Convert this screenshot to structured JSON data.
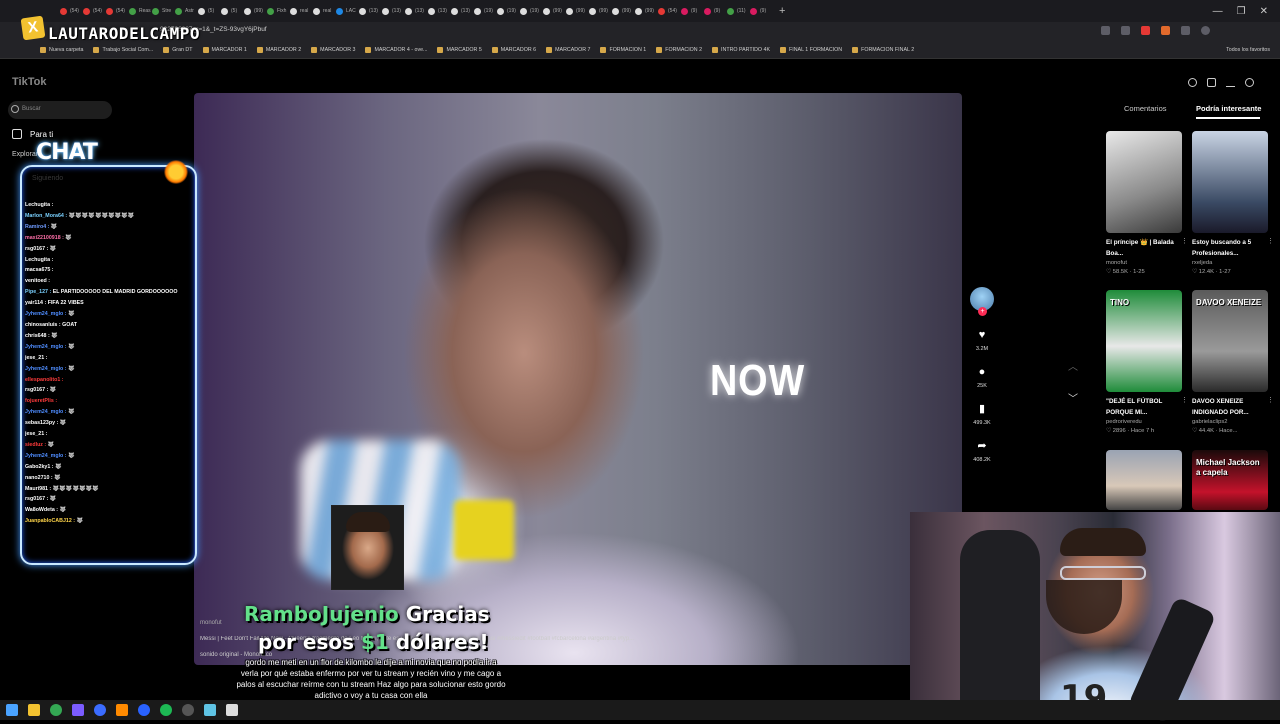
{
  "browser": {
    "tabs": [
      {
        "label": "(54)",
        "color": "#e53935"
      },
      {
        "label": "(54)",
        "color": "#e53935"
      },
      {
        "label": "(54)",
        "color": "#e53935"
      },
      {
        "label": "Reas",
        "color": "#43a047"
      },
      {
        "label": "Stre",
        "color": "#43a047"
      },
      {
        "label": "Astr",
        "color": "#43a047"
      },
      {
        "label": "(5)",
        "color": "#dddddd"
      },
      {
        "label": "(5)",
        "color": "#dddddd"
      },
      {
        "label": "(99)",
        "color": "#dddddd"
      },
      {
        "label": "Fixh",
        "color": "#43a047"
      },
      {
        "label": "real",
        "color": "#dddddd"
      },
      {
        "label": "real",
        "color": "#dddddd"
      },
      {
        "label": "LAC",
        "color": "#1e88e5"
      },
      {
        "label": "(13)",
        "color": "#dddddd"
      },
      {
        "label": "(13)",
        "color": "#dddddd"
      },
      {
        "label": "(13)",
        "color": "#dddddd"
      },
      {
        "label": "(13)",
        "color": "#dddddd"
      },
      {
        "label": "(13)",
        "color": "#dddddd"
      },
      {
        "label": "(19)",
        "color": "#dddddd"
      },
      {
        "label": "(19)",
        "color": "#dddddd"
      },
      {
        "label": "(19)",
        "color": "#dddddd"
      },
      {
        "label": "(99)",
        "color": "#dddddd"
      },
      {
        "label": "(99)",
        "color": "#dddddd"
      },
      {
        "label": "(99)",
        "color": "#dddddd"
      },
      {
        "label": "(99)",
        "color": "#dddddd"
      },
      {
        "label": "(99)",
        "color": "#dddddd"
      },
      {
        "label": "(54)",
        "color": "#e53935"
      },
      {
        "label": "(9)",
        "color": "#d81b60"
      },
      {
        "label": "(9)",
        "color": "#d81b60"
      },
      {
        "label": "(11)",
        "color": "#43a047"
      },
      {
        "label": "(9)",
        "color": "#d81b60"
      }
    ],
    "new_tab": "+",
    "window_controls": [
      "—",
      "❐",
      "✕"
    ],
    "url": "982796927_r=1&_t=ZS-93vgY6jPbuf",
    "bookmarks": [
      "Nueva carpeta",
      "Trabajo Social Com...",
      "Gran DT",
      "MARCADOR 1",
      "MARCADOR 2",
      "MARCADOR 3",
      "MARCADOR 4 - ove...",
      "MARCADOR 5",
      "MARCADOR 6",
      "MARCADOR 7",
      "FORMACION 1",
      "FORMACION 2",
      "INTRO PARTIDO 4K",
      "FINAL 1 FORMACION",
      "FORMACION FINAL 2"
    ],
    "all_bookmarks": "Todos los favoritos"
  },
  "overlay": {
    "logo": "LAUTARODELCAMPO",
    "chat_title": "CHAT",
    "chat": [
      {
        "user": "Lechugita :",
        "msg": "",
        "em": ""
      },
      {
        "user": "Marlon_Mora64 :",
        "msg": "",
        "em": "🐺🐺🐺🐺🐺🐺🐺🐺🐺🐺"
      },
      {
        "user": "Ramiro4 :",
        "msg": "",
        "em": "🐺"
      },
      {
        "user": "maxi22100918 :",
        "msg": "",
        "em": "🐺"
      },
      {
        "user": "rsg0167 :",
        "msg": "",
        "em": "🐺"
      },
      {
        "user": "Lechugita :",
        "msg": "",
        "em": ""
      },
      {
        "user": "macsa675 :",
        "msg": "",
        "em": ""
      },
      {
        "user": "venitoed :",
        "msg": "",
        "em": ""
      },
      {
        "user": "Pipe_127 :",
        "msg": "EL PARTIDOOOOO DEL MADRID GORDOOOOOO",
        "em": ""
      },
      {
        "user": "yair114 :",
        "msg": "FIFA 22 VIBES",
        "em": ""
      },
      {
        "user": "Jyhem24_mglo :",
        "msg": "",
        "em": "🐺"
      },
      {
        "user": "chinosanluis :",
        "msg": "GOAT",
        "em": ""
      },
      {
        "user": "chris648 :",
        "msg": "",
        "em": "🐺"
      },
      {
        "user": "Jyhem24_mglo :",
        "msg": "",
        "em": "🐺"
      },
      {
        "user": "jese_21 :",
        "msg": "",
        "em": ""
      },
      {
        "user": "Jyhem24_mglo :",
        "msg": "",
        "em": "🐺"
      },
      {
        "user": "ellespanolito1 :",
        "msg": "",
        "em": ""
      },
      {
        "user": "rsg0167 :",
        "msg": "",
        "em": "🐺"
      },
      {
        "user": "fojueretPlis :",
        "msg": "",
        "em": ""
      },
      {
        "user": "Jyhem24_mglo :",
        "msg": "",
        "em": "🐺"
      },
      {
        "user": "sebas123py :",
        "msg": "",
        "em": "🐺"
      },
      {
        "user": "jese_21 :",
        "msg": "",
        "em": ""
      },
      {
        "user": "siedluz :",
        "msg": "",
        "em": "🐺"
      },
      {
        "user": "Jyhem24_mglo :",
        "msg": "",
        "em": "🐺"
      },
      {
        "user": "Gabo2ky1 :",
        "msg": "",
        "em": "🐺"
      },
      {
        "user": "nano2710 :",
        "msg": "",
        "em": "🐺"
      },
      {
        "user": "Mauri981 :",
        "msg": "",
        "em": "🐺🐺🐺🐺🐺🐺🐺"
      },
      {
        "user": "rsg0167 :",
        "msg": "",
        "em": "🐺"
      },
      {
        "user": "Wa8oWdeta :",
        "msg": "",
        "em": "🐺"
      },
      {
        "user": "JuanpabloCABJ12 :",
        "msg": "",
        "em": "🐺"
      }
    ],
    "user_colors": [
      "#ffffff",
      "#7ad1ff",
      "#6f9bff",
      "#ff6fa8",
      "#ffffff",
      "#ffffff",
      "#ffffff",
      "#ffffff",
      "#7ad1ff",
      "#ffffff",
      "#4f8dff",
      "#ffffff",
      "#ffffff",
      "#4f8dff",
      "#ffffff",
      "#4f8dff",
      "#ff3b3b",
      "#ffffff",
      "#ff3b3b",
      "#4f8dff",
      "#ffffff",
      "#ffffff",
      "#ff3b3b",
      "#4f8dff",
      "#ffffff",
      "#ffffff",
      "#ffffff",
      "#ffffff",
      "#ffffff",
      "#ffd54a"
    ],
    "alert": {
      "user": "RamboJujenio",
      "text1": "Gracias",
      "text2a": "por esos",
      "amount": "$1",
      "text2b": "dólares!",
      "message": "gordo me meti en un flor de kilombo le dije a mi novia que no podia ir a verla por qué estaba enfermo por ver tu stream y recién vino y me cago a palos al escuchar reírme con tu stream Haz algo para solucionar esto gordo adictivo o voy a tu casa con ella"
    },
    "cam_number": "19"
  },
  "tiktok": {
    "logo": "TikTok",
    "search_placeholder": "Buscar",
    "nav": {
      "for_you": "Para ti",
      "explore": "Explorar",
      "following": "Siguiendo"
    },
    "video": {
      "overlay_text": "NOW",
      "author": "monofut",
      "caption": "Messi | Feet Don't Fail Me Now - Queen's fragmento de Leo Messi, este es un fragmento de sus videos #messi #messiedit #football #fcbarcelona #argentina #fyp...",
      "sound": "sonido original - Monofutco"
    },
    "actions": {
      "likes": "3.2M",
      "comments": "25K",
      "saves": "499.3K",
      "shares": "408.2K"
    },
    "panel": {
      "tab_comments": "Comentarios",
      "tab_interesting": "Podría interesante",
      "cards": [
        {
          "title": "El príncipe 👑 | Balada Boa...",
          "author": "monofut",
          "meta": "♡ 58.5K · 1-25"
        },
        {
          "title": "Estoy buscando a 5 Profesionales...",
          "author": "rxeljeda",
          "meta": "♡ 12.4K · 1-27"
        },
        {
          "title": "\"DEJÉ EL FÚTBOL PORQUE MI...",
          "author": "pedroriveredu",
          "meta": "♡ 2896 · Hace 7 h"
        },
        {
          "title": "DAVOO XENEIZE INDIGNADO POR...",
          "author": "gabrielaclips2",
          "meta": "♡ 44.4K · Hace..."
        },
        {
          "title": "",
          "author": "",
          "meta": ""
        },
        {
          "title": "",
          "author": "",
          "meta": ""
        }
      ],
      "thumb_texts": [
        "",
        "",
        "TINO",
        "DAVOO XENEIZE",
        "",
        "Michael Jackson a capela"
      ]
    }
  }
}
